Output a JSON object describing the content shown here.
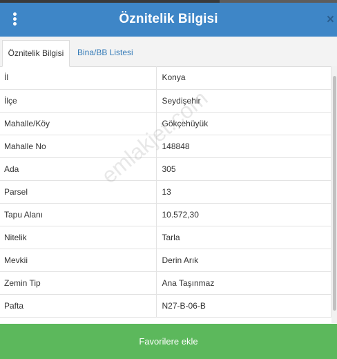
{
  "header": {
    "title": "Öznitelik Bilgisi",
    "menu_icon": "kebab-menu-icon",
    "close_icon": "close-icon",
    "close_glyph": "×"
  },
  "tabs": [
    {
      "label": "Öznitelik Bilgisi",
      "active": true
    },
    {
      "label": "Bina/BB Listesi",
      "active": false
    }
  ],
  "attributes": [
    {
      "key": "İl",
      "value": "Konya"
    },
    {
      "key": "İlçe",
      "value": "Seydişehir"
    },
    {
      "key": "Mahalle/Köy",
      "value": "Gökçehüyük"
    },
    {
      "key": "Mahalle No",
      "value": "148848"
    },
    {
      "key": "Ada",
      "value": "305"
    },
    {
      "key": "Parsel",
      "value": "13"
    },
    {
      "key": "Tapu Alanı",
      "value": "10.572,30"
    },
    {
      "key": "Nitelik",
      "value": "Tarla"
    },
    {
      "key": "Mevkii",
      "value": "Derin Arık"
    },
    {
      "key": "Zemin Tip",
      "value": "Ana Taşınmaz"
    },
    {
      "key": "Pafta",
      "value": "N27-B-06-B"
    }
  ],
  "watermark": "emlakjet.com",
  "footer": {
    "button_label": "Favorilere ekle"
  },
  "colors": {
    "header": "#3e86c7",
    "footer": "#5cb85c",
    "link": "#337ab7"
  }
}
